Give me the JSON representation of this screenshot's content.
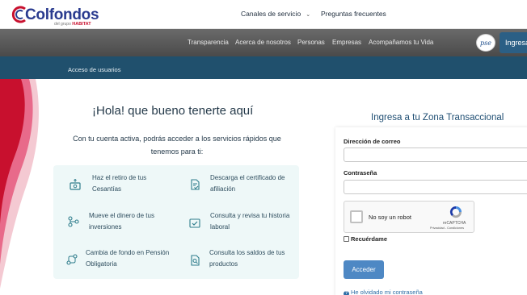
{
  "brand": {
    "name": "Colfondos",
    "tagline_prefix": "del grupo",
    "tagline_brand": "HABITAT"
  },
  "topnav": {
    "services_label": "Canales de servicio",
    "faq_label": "Preguntas frecuentes"
  },
  "mainnav": {
    "items": [
      "Transparencia",
      "Acerca de nosotros",
      "Personas",
      "Empresas",
      "Acompañamos tu Vida"
    ],
    "pse_label": "pse",
    "login_button": "Ingresa"
  },
  "subnav": {
    "link": "Acceso de usuarios"
  },
  "welcome": {
    "title": "¡Hola! que bueno tenerte aquí",
    "intro": "Con tu cuenta activa, podrás acceder a los servicios rápidos que tenemos para ti:"
  },
  "services": [
    {
      "icon": "money-withdraw-icon",
      "label": "Haz el retiro de tus Cesantías"
    },
    {
      "icon": "certificate-download-icon",
      "label": "Descarga el certificado de afiliación"
    },
    {
      "icon": "transfer-icon",
      "label": "Mueve el dinero de tus inversiones"
    },
    {
      "icon": "history-check-icon",
      "label": "Consulta y revisa tu historia laboral"
    },
    {
      "icon": "fund-change-icon",
      "label": "Cambia de fondo en Pensión Obligatoria"
    },
    {
      "icon": "balance-search-icon",
      "label": "Consulta los saldos de tus productos"
    }
  ],
  "login": {
    "title": "Ingresa a tu Zona Transaccional",
    "email_label": "Dirección de correo",
    "email_value": "",
    "password_label": "Contraseña",
    "password_value": "",
    "captcha_label": "No soy un robot",
    "captcha_brand": "reCAPTCHA",
    "captcha_terms": "Privacidad - Condiciones",
    "remember_label": "Recuérdame",
    "submit_label": "Acceder",
    "forgot_label": "He olvidado mi contraseña"
  },
  "colors": {
    "primary": "#20506d",
    "accent": "#4e88c4",
    "brand_red": "#c8102e",
    "services_bg": "#eef8f8"
  }
}
